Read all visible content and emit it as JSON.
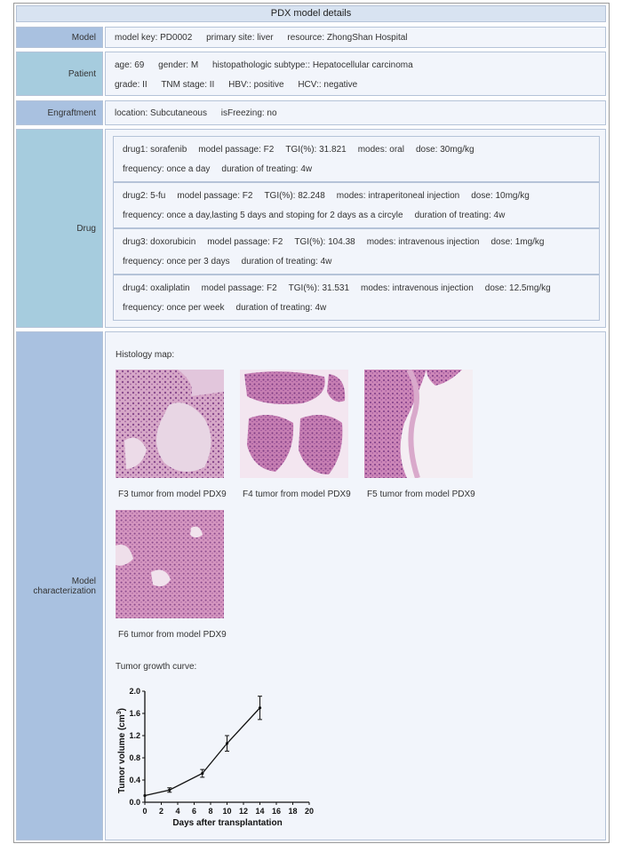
{
  "page_title": "PDX model details",
  "model": {
    "label": "Model",
    "fields": [
      "model key: PD0002",
      "primary site: liver",
      "resource: ZhongShan Hospital"
    ]
  },
  "patient": {
    "label": "Patient",
    "row1": [
      "age: 69",
      "gender: M",
      "histopathologic subtype:: Hepatocellular carcinoma"
    ],
    "row2": [
      "grade: II",
      "TNM stage: II",
      "HBV:: positive",
      "HCV:: negative"
    ]
  },
  "engraftment": {
    "label": "Engraftment",
    "fields": [
      "location: Subcutaneous",
      "isFreezing: no"
    ]
  },
  "drug": {
    "label": "Drug",
    "items": [
      {
        "row1": [
          "drug1: sorafenib",
          "model passage: F2",
          "TGI(%): 31.821",
          "modes: oral",
          "dose: 30mg/kg"
        ],
        "row2": [
          "frequency: once a day",
          "duration of treating: 4w"
        ]
      },
      {
        "row1": [
          "drug2: 5-fu",
          "model passage: F2",
          "TGI(%): 82.248",
          "modes: intraperitoneal injection",
          "dose: 10mg/kg"
        ],
        "row2": [
          "frequency: once a day,lasting 5 days and stoping for 2 days as a circyle",
          "duration of treating: 4w"
        ]
      },
      {
        "row1": [
          "drug3: doxorubicin",
          "model passage: F2",
          "TGI(%): 104.38",
          "modes: intravenous injection",
          "dose: 1mg/kg"
        ],
        "row2": [
          "frequency: once per 3 days",
          "duration of treating: 4w"
        ]
      },
      {
        "row1": [
          "drug4: oxaliplatin",
          "model passage: F2",
          "TGI(%): 31.531",
          "modes: intravenous injection",
          "dose: 12.5mg/kg"
        ],
        "row2": [
          "frequency: once per week",
          "duration of treating: 4w"
        ]
      }
    ]
  },
  "characterization": {
    "label_line1": "Model",
    "label_line2": "characterization",
    "histology_title": "Histology map:",
    "images": [
      {
        "caption": "F3 tumor from model PDX9"
      },
      {
        "caption": "F4 tumor from model PDX9"
      },
      {
        "caption": "F5 tumor from model PDX9"
      },
      {
        "caption": "F6 tumor from model PDX9"
      }
    ],
    "growth_title": "Tumor growth curve:"
  },
  "chart_data": {
    "type": "line",
    "xlabel": "Days after transplantation",
    "ylabel": "Tumor volume (cm³)",
    "ylabel_main": "Tumor volume (cm",
    "ylabel_sup": "3",
    "ylabel_end": ")",
    "xlim": [
      0,
      20
    ],
    "ylim": [
      0.0,
      2.0
    ],
    "x_ticks": [
      "0",
      "2",
      "4",
      "6",
      "8",
      "10",
      "12",
      "14",
      "16",
      "18",
      "20"
    ],
    "y_ticks": [
      "0.0",
      "0.4",
      "0.8",
      "1.2",
      "1.6",
      "2.0"
    ],
    "x": [
      0,
      3,
      7,
      10,
      14
    ],
    "y": [
      0.12,
      0.22,
      0.52,
      1.06,
      1.7
    ],
    "err": [
      0,
      0.04,
      0.07,
      0.14,
      0.21
    ]
  }
}
